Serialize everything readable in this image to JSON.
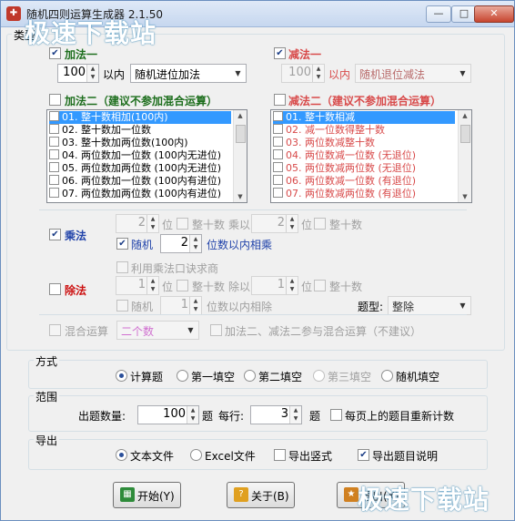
{
  "window": {
    "title": "随机四则运算生成器 2.1.50",
    "minimize": "—",
    "maximize": "□",
    "close": "✕"
  },
  "watermark": "极速下载站",
  "type_group": {
    "label": "类型"
  },
  "add1": {
    "checked": true,
    "label": "加法一",
    "limit_value": "100",
    "limit_suffix": "以内",
    "mode": "随机进位加法"
  },
  "sub1": {
    "checked": true,
    "label": "减法一",
    "limit_value": "100",
    "limit_suffix": "以内",
    "mode": "随机退位减法"
  },
  "add2": {
    "checked": false,
    "label": "加法二（建议不参加混合运算）",
    "items": [
      "01. 整十数相加(100内)",
      "02. 整十数加一位数",
      "03. 整十数加两位数(100内)",
      "04. 两位数加一位数 (100内无进位)",
      "05. 两位数加两位数 (100内无进位)",
      "06. 两位数加一位数 (100内有进位)",
      "07. 两位数加两位数 (100内有进位)"
    ]
  },
  "sub2": {
    "checked": false,
    "label": "减法二（建议不参加混合运算）",
    "items": [
      "01. 整十数相减",
      "02. 减一位数得整十数",
      "03. 两位数减整十数",
      "04. 两位数减一位数 (无退位)",
      "05. 两位数减两位数 (无退位)",
      "06. 两位数减一位数 (有退位)",
      "07. 两位数减两位数 (有退位)"
    ]
  },
  "mul": {
    "checked": true,
    "label": "乘法",
    "digits1": "2",
    "digit_word": "位",
    "whole_ten": "整十数",
    "times_word": "乘以",
    "digits2": "2",
    "random_checked": true,
    "random_label": "随机",
    "random_digits": "2",
    "random_suffix": "位数以内相乘"
  },
  "div": {
    "checked": false,
    "label": "除法",
    "use_mul_table": "利用乘法口诀求商",
    "digits1": "1",
    "digit_word": "位",
    "whole_ten": "整十数",
    "div_word": "除以",
    "digits2": "1",
    "random_label": "随机",
    "random_digits": "1",
    "random_suffix": "位数以内相除",
    "type_label": "题型:",
    "type_value": "整除"
  },
  "mixed": {
    "checked": false,
    "label": "混合运算",
    "count": "二个数",
    "add2_sub2_label": "加法二、减法二参与混合运算（不建议）"
  },
  "method": {
    "label": "方式",
    "options": [
      "计算题",
      "第一填空",
      "第二填空",
      "第三填空",
      "随机填空"
    ],
    "selected": 0
  },
  "range": {
    "label": "范围",
    "count_label": "出题数量:",
    "count_value": "100",
    "count_unit": "题",
    "per_line_label": "每行:",
    "per_line_value": "3",
    "per_line_unit": "题",
    "recount_label": "每页上的题目重新计数"
  },
  "export": {
    "label": "导出",
    "text_file": "文本文件",
    "excel_file": "Excel文件",
    "vertical": "导出竖式",
    "description": "导出题目说明",
    "selected": "text"
  },
  "buttons": {
    "start": "开始(Y)",
    "about": "关于(B)",
    "exit": "退出(X)"
  },
  "colors": {
    "accent_blue": "#3399ff",
    "add_green": "#1d6e1d",
    "sub_red": "#d84a4a",
    "mul_blue": "#2244aa",
    "div_red": "#cc1111"
  }
}
